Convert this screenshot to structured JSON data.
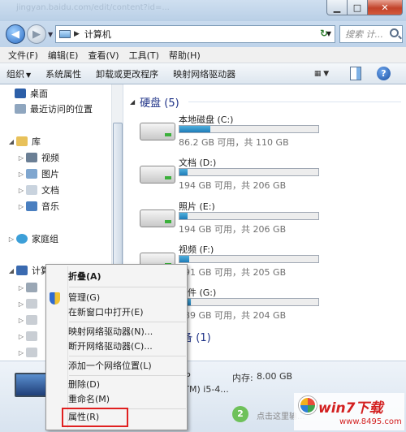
{
  "window": {
    "ghost_url": "jingyan.baidu.com/edit/content?id=..."
  },
  "address": {
    "path": "计算机",
    "search_placeholder": "搜索 计..."
  },
  "menu": [
    "文件(F)",
    "编辑(E)",
    "查看(V)",
    "工具(T)",
    "帮助(H)"
  ],
  "toolbar": [
    "组织",
    "系统属性",
    "卸载或更改程序",
    "映射网络驱动器"
  ],
  "sidebar": {
    "items": [
      {
        "label": "桌面"
      },
      {
        "label": "最近访问的位置"
      },
      {
        "label": "库"
      },
      {
        "label": "视频"
      },
      {
        "label": "图片"
      },
      {
        "label": "文档"
      },
      {
        "label": "音乐"
      },
      {
        "label": "家庭组"
      },
      {
        "label": "计算机"
      }
    ]
  },
  "main": {
    "group_harddisk": "硬盘 (5)",
    "group_removable": "存储的设备 (1)",
    "drives": [
      {
        "name": "本地磁盘 (C:)",
        "info": "86.2 GB 可用，共 110 GB",
        "used_frac": 0.22
      },
      {
        "name": "文档 (D:)",
        "info": "194 GB 可用，共 206 GB",
        "used_frac": 0.06
      },
      {
        "name": "照片 (E:)",
        "info": "194 GB 可用，共 206 GB",
        "used_frac": 0.06
      },
      {
        "name": "视频 (F:)",
        "info": "191 GB 可用，共 205 GB",
        "used_frac": 0.07
      },
      {
        "name": "软件 (G:)",
        "info": "189 GB 可用，共 204 GB",
        "used_frac": 0.08
      }
    ]
  },
  "context_menu": {
    "items": [
      "折叠(A)",
      "管理(G)",
      "在新窗口中打开(E)",
      "映射网络驱动器(N)...",
      "断开网络驱动器(C)...",
      "添加一个网络位置(L)",
      "删除(D)",
      "重命名(M)",
      "属性(R)"
    ]
  },
  "details": {
    "memory_label": "内存:",
    "memory_value": "8.00 GB",
    "cpu": "(TM) i5-4...",
    "step": "2",
    "hint": "点击这里输..."
  },
  "watermark": {
    "title": "win7下载",
    "url": "www.8495.com"
  }
}
